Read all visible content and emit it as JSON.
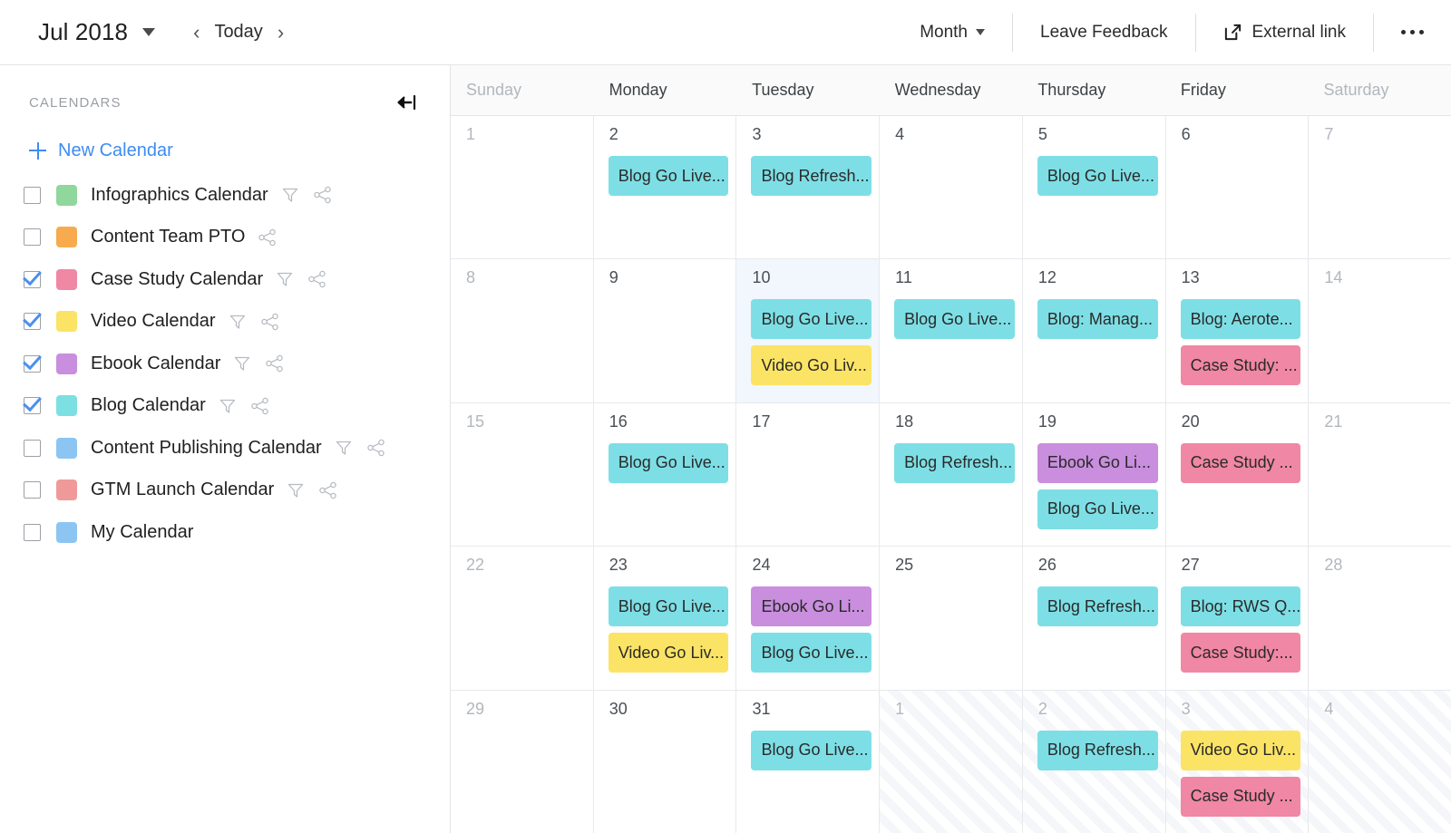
{
  "topbar": {
    "month_label": "Jul 2018",
    "month_caret_icon": "chevron-down-icon",
    "prev_label": "‹",
    "today_label": "Today",
    "next_label": "›",
    "view_label": "Month",
    "feedback_label": "Leave Feedback",
    "external_link_label": "External link",
    "external_link_icon": "external-link-icon",
    "more_icon": "ellipsis-icon"
  },
  "sidebar": {
    "header_title": "CALENDARS",
    "collapse_icon": "collapse-left-icon",
    "new_calendar_label": "New Calendar",
    "accent_color": "#3d8bf2",
    "items": [
      {
        "label": "Infographics Calendar",
        "color": "#8fd79a",
        "checked": false,
        "filter": true,
        "share": true
      },
      {
        "label": "Content Team PTO",
        "color": "#f7ab4e",
        "checked": false,
        "filter": false,
        "share": true
      },
      {
        "label": "Case Study Calendar",
        "color": "#f087a4",
        "checked": true,
        "filter": true,
        "share": true
      },
      {
        "label": "Video Calendar",
        "color": "#fbe465",
        "checked": true,
        "filter": true,
        "share": true
      },
      {
        "label": "Ebook Calendar",
        "color": "#c98ede",
        "checked": true,
        "filter": true,
        "share": true
      },
      {
        "label": "Blog Calendar",
        "color": "#7ce0e2",
        "checked": true,
        "filter": true,
        "share": true
      },
      {
        "label": "Content Publishing Calendar",
        "color": "#8cc5f2",
        "checked": false,
        "filter": true,
        "share": true
      },
      {
        "label": "GTM Launch Calendar",
        "color": "#ef9a99",
        "checked": false,
        "filter": true,
        "share": true
      },
      {
        "label": "My Calendar",
        "color": "#8cc5f2",
        "checked": false,
        "filter": false,
        "share": false
      }
    ]
  },
  "calendar": {
    "day_headers": [
      {
        "label": "Sunday",
        "weekend": true
      },
      {
        "label": "Monday",
        "weekend": false
      },
      {
        "label": "Tuesday",
        "weekend": false
      },
      {
        "label": "Wednesday",
        "weekend": false
      },
      {
        "label": "Thursday",
        "weekend": false
      },
      {
        "label": "Friday",
        "weekend": false
      },
      {
        "label": "Saturday",
        "weekend": true
      }
    ],
    "event_colors": {
      "blog": "#7ddfe5",
      "video": "#fbe465",
      "ebook": "#c98ede",
      "case_study": "#f087a4"
    },
    "weeks": [
      [
        {
          "day": "1",
          "dim": true,
          "outside": false,
          "today": false,
          "events": []
        },
        {
          "day": "2",
          "dim": false,
          "outside": false,
          "today": false,
          "events": [
            {
              "title": "Blog Go Live...",
              "color": "#7ddfe5"
            }
          ]
        },
        {
          "day": "3",
          "dim": false,
          "outside": false,
          "today": false,
          "events": [
            {
              "title": "Blog Refresh...",
              "color": "#7ddfe5"
            }
          ]
        },
        {
          "day": "4",
          "dim": false,
          "outside": false,
          "today": false,
          "events": []
        },
        {
          "day": "5",
          "dim": false,
          "outside": false,
          "today": false,
          "events": [
            {
              "title": "Blog Go Live...",
              "color": "#7ddfe5"
            }
          ]
        },
        {
          "day": "6",
          "dim": false,
          "outside": false,
          "today": false,
          "events": []
        },
        {
          "day": "7",
          "dim": true,
          "outside": false,
          "today": false,
          "events": []
        }
      ],
      [
        {
          "day": "8",
          "dim": true,
          "outside": false,
          "today": false,
          "events": []
        },
        {
          "day": "9",
          "dim": false,
          "outside": false,
          "today": false,
          "events": []
        },
        {
          "day": "10",
          "dim": false,
          "outside": false,
          "today": true,
          "events": [
            {
              "title": "Blog Go Live...",
              "color": "#7ddfe5"
            },
            {
              "title": "Video Go Liv...",
              "color": "#fbe465"
            }
          ]
        },
        {
          "day": "11",
          "dim": false,
          "outside": false,
          "today": false,
          "events": [
            {
              "title": "Blog Go Live...",
              "color": "#7ddfe5"
            }
          ]
        },
        {
          "day": "12",
          "dim": false,
          "outside": false,
          "today": false,
          "events": [
            {
              "title": "Blog: Manag...",
              "color": "#7ddfe5"
            }
          ]
        },
        {
          "day": "13",
          "dim": false,
          "outside": false,
          "today": false,
          "events": [
            {
              "title": "Blog: Aerote...",
              "color": "#7ddfe5"
            },
            {
              "title": "Case Study: ...",
              "color": "#f087a4"
            }
          ]
        },
        {
          "day": "14",
          "dim": true,
          "outside": false,
          "today": false,
          "events": []
        }
      ],
      [
        {
          "day": "15",
          "dim": true,
          "outside": false,
          "today": false,
          "events": []
        },
        {
          "day": "16",
          "dim": false,
          "outside": false,
          "today": false,
          "events": [
            {
              "title": "Blog Go Live...",
              "color": "#7ddfe5"
            }
          ]
        },
        {
          "day": "17",
          "dim": false,
          "outside": false,
          "today": false,
          "events": []
        },
        {
          "day": "18",
          "dim": false,
          "outside": false,
          "today": false,
          "events": [
            {
              "title": "Blog Refresh...",
              "color": "#7ddfe5"
            }
          ]
        },
        {
          "day": "19",
          "dim": false,
          "outside": false,
          "today": false,
          "events": [
            {
              "title": "Ebook Go Li...",
              "color": "#c98ede"
            },
            {
              "title": "Blog Go Live...",
              "color": "#7ddfe5"
            }
          ]
        },
        {
          "day": "20",
          "dim": false,
          "outside": false,
          "today": false,
          "events": [
            {
              "title": "Case Study ...",
              "color": "#f087a4"
            }
          ]
        },
        {
          "day": "21",
          "dim": true,
          "outside": false,
          "today": false,
          "events": []
        }
      ],
      [
        {
          "day": "22",
          "dim": true,
          "outside": false,
          "today": false,
          "events": []
        },
        {
          "day": "23",
          "dim": false,
          "outside": false,
          "today": false,
          "events": [
            {
              "title": "Blog Go Live...",
              "color": "#7ddfe5"
            },
            {
              "title": "Video Go Liv...",
              "color": "#fbe465"
            }
          ]
        },
        {
          "day": "24",
          "dim": false,
          "outside": false,
          "today": false,
          "events": [
            {
              "title": "Ebook Go Li...",
              "color": "#c98ede"
            },
            {
              "title": "Blog Go Live...",
              "color": "#7ddfe5"
            }
          ]
        },
        {
          "day": "25",
          "dim": false,
          "outside": false,
          "today": false,
          "events": []
        },
        {
          "day": "26",
          "dim": false,
          "outside": false,
          "today": false,
          "events": [
            {
              "title": "Blog Refresh...",
              "color": "#7ddfe5"
            }
          ]
        },
        {
          "day": "27",
          "dim": false,
          "outside": false,
          "today": false,
          "events": [
            {
              "title": "Blog: RWS Q...",
              "color": "#7ddfe5"
            },
            {
              "title": "Case Study:...",
              "color": "#f087a4"
            }
          ]
        },
        {
          "day": "28",
          "dim": true,
          "outside": false,
          "today": false,
          "events": []
        }
      ],
      [
        {
          "day": "29",
          "dim": true,
          "outside": false,
          "today": false,
          "events": []
        },
        {
          "day": "30",
          "dim": false,
          "outside": false,
          "today": false,
          "events": []
        },
        {
          "day": "31",
          "dim": false,
          "outside": false,
          "today": false,
          "events": [
            {
              "title": "Blog Go Live...",
              "color": "#7ddfe5"
            }
          ]
        },
        {
          "day": "1",
          "dim": true,
          "outside": true,
          "today": false,
          "events": []
        },
        {
          "day": "2",
          "dim": true,
          "outside": true,
          "today": false,
          "events": [
            {
              "title": "Blog Refresh...",
              "color": "#7ddfe5"
            }
          ]
        },
        {
          "day": "3",
          "dim": true,
          "outside": true,
          "today": false,
          "events": [
            {
              "title": "Video Go Liv...",
              "color": "#fbe465"
            },
            {
              "title": "Case Study ...",
              "color": "#f087a4"
            }
          ]
        },
        {
          "day": "4",
          "dim": true,
          "outside": true,
          "today": false,
          "events": []
        }
      ]
    ]
  }
}
